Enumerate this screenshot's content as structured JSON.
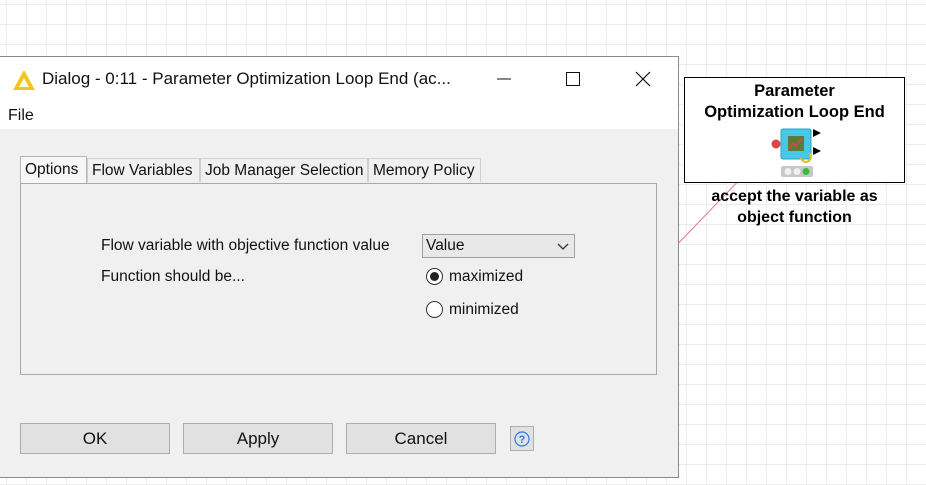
{
  "dialog": {
    "title": "Dialog - 0:11 - Parameter Optimization Loop End (ac...",
    "menu": {
      "file": "File"
    },
    "tabs": [
      {
        "label": "Options",
        "active": true
      },
      {
        "label": "Flow Variables",
        "active": false
      },
      {
        "label": "Job Manager Selection",
        "active": false
      },
      {
        "label": "Memory Policy",
        "active": false
      }
    ],
    "options": {
      "objective_label": "Flow variable with objective function value",
      "objective_value": "Value",
      "function_label": "Function should be...",
      "radio_options": [
        {
          "label": "maximized",
          "checked": true
        },
        {
          "label": "minimized",
          "checked": false
        }
      ]
    },
    "buttons": {
      "ok": "OK",
      "apply": "Apply",
      "cancel": "Cancel"
    }
  },
  "node": {
    "title_line1": "Parameter",
    "title_line2": "Optimization Loop End",
    "caption_line1": "accept the variable as",
    "caption_line2": "object function"
  },
  "colors": {
    "accent_yellow": "#f5c518",
    "connection_red": "#e04545",
    "node_cyan": "#46c8e6",
    "help_blue": "#2c7be0"
  }
}
